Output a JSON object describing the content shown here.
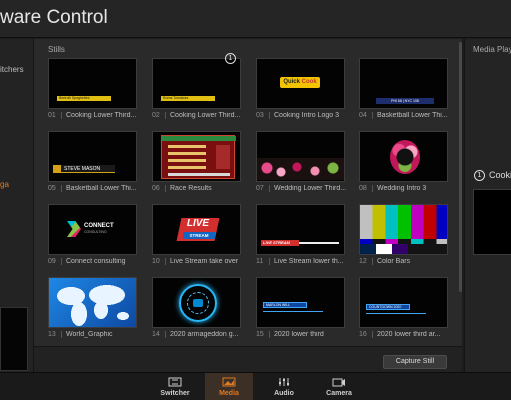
{
  "app": {
    "title": "ware Control"
  },
  "left_panel": {
    "switchers_label": "itchers",
    "active_item_label": "ga"
  },
  "stills": {
    "header": "Stills",
    "capture_button": "Capture Still",
    "active_badge": "1",
    "items": [
      {
        "num": "01",
        "label": "Cooking Lower Third...",
        "bar": "Bertrolli Spaghettini",
        "barColor": "#e2c012"
      },
      {
        "num": "02",
        "label": "Cooking Lower Third...",
        "bar": "Roma Tomatoes",
        "barColor": "#e2c012"
      },
      {
        "num": "03",
        "label": "Cooking Intro Logo 3",
        "logo1": "Quick",
        "logo2": "Cook"
      },
      {
        "num": "04",
        "label": "Basketball Lower Thi...",
        "score": "PHI 68",
        "score2": "NYC 108"
      },
      {
        "num": "05",
        "label": "Basketball Lower Thi...",
        "name": "STEVE MASON"
      },
      {
        "num": "06",
        "label": "Race Results"
      },
      {
        "num": "07",
        "label": "Wedding Lower Third..."
      },
      {
        "num": "08",
        "label": "Wedding Intro 3"
      },
      {
        "num": "09",
        "label": "Connect consulting",
        "brand": "CONNECT",
        "brand_sub": "CONSULTING"
      },
      {
        "num": "10",
        "label": "Live Stream take over",
        "live1": "LIVE",
        "live2": "STREAM"
      },
      {
        "num": "11",
        "label": "Live Stream lower th...",
        "live3": "LIVE STREAM"
      },
      {
        "num": "12",
        "label": "Color Bars"
      },
      {
        "num": "13",
        "label": "World_Graphic"
      },
      {
        "num": "14",
        "label": "2020 armageddon g..."
      },
      {
        "num": "15",
        "label": "2020 lower third",
        "lt": "MARLON WILL"
      },
      {
        "num": "16",
        "label": "2020 lower third ar...",
        "lt": "COUNTDOWN 2020"
      }
    ]
  },
  "media_player": {
    "header": "Media Playe",
    "badge": "1",
    "label": "Cooking"
  },
  "tabs": [
    {
      "label": "Switcher",
      "icon": "switcher-icon",
      "active": false
    },
    {
      "label": "Media",
      "icon": "media-icon",
      "active": true
    },
    {
      "label": "Audio",
      "icon": "audio-icon",
      "active": false
    },
    {
      "label": "Camera",
      "icon": "camera-icon",
      "active": false
    }
  ],
  "colors": {
    "accent": "#e07a1f",
    "panel": "#2a2a2a",
    "background": "#1c1c1c"
  }
}
